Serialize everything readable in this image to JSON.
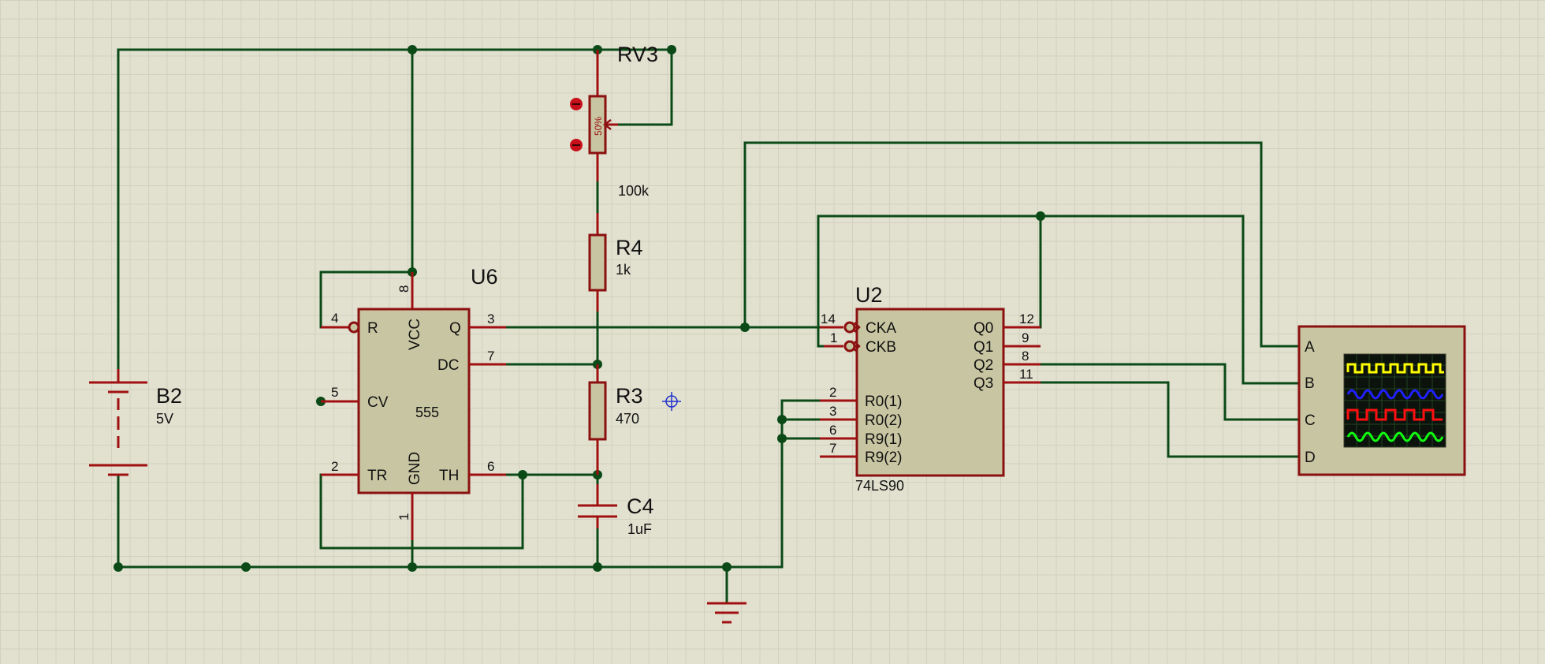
{
  "components": {
    "battery": {
      "ref": "B2",
      "value": "5V"
    },
    "pot": {
      "ref": "RV3",
      "value": "100k",
      "wiper": "50%"
    },
    "r4": {
      "ref": "R4",
      "value": "1k"
    },
    "r3": {
      "ref": "R3",
      "value": "470"
    },
    "c4": {
      "ref": "C4",
      "value": "1uF"
    },
    "timer": {
      "ref": "U6",
      "type": "555",
      "pins": {
        "r": {
          "name": "R",
          "num": "4"
        },
        "vcc": {
          "name": "VCC",
          "num": "8"
        },
        "q": {
          "name": "Q",
          "num": "3"
        },
        "dc": {
          "name": "DC",
          "num": "7"
        },
        "cv": {
          "name": "CV",
          "num": "5"
        },
        "tr": {
          "name": "TR",
          "num": "2"
        },
        "gnd": {
          "name": "GND",
          "num": "1"
        },
        "th": {
          "name": "TH",
          "num": "6"
        }
      }
    },
    "counter": {
      "ref": "U2",
      "type": "74LS90",
      "pins": {
        "cka": {
          "name": "CKA",
          "num": "14"
        },
        "ckb": {
          "name": "CKB",
          "num": "1"
        },
        "r01": {
          "name": "R0(1)",
          "num": "2"
        },
        "r02": {
          "name": "R0(2)",
          "num": "3"
        },
        "r91": {
          "name": "R9(1)",
          "num": "6"
        },
        "r92": {
          "name": "R9(2)",
          "num": "7"
        },
        "q0": {
          "name": "Q0",
          "num": "12"
        },
        "q1": {
          "name": "Q1",
          "num": "9"
        },
        "q2": {
          "name": "Q2",
          "num": "8"
        },
        "q3": {
          "name": "Q3",
          "num": "11"
        }
      }
    },
    "scope": {
      "channels": [
        {
          "name": "A",
          "color": "#ffff00"
        },
        {
          "name": "B",
          "color": "#2222ff"
        },
        {
          "name": "C",
          "color": "#ff1010"
        },
        {
          "name": "D",
          "color": "#10ff10"
        }
      ]
    }
  },
  "colors": {
    "wire": "#0b4a17",
    "component": "#8b1010",
    "body_fill": "#c8c6a2",
    "sheet": "#e2e1d0"
  }
}
